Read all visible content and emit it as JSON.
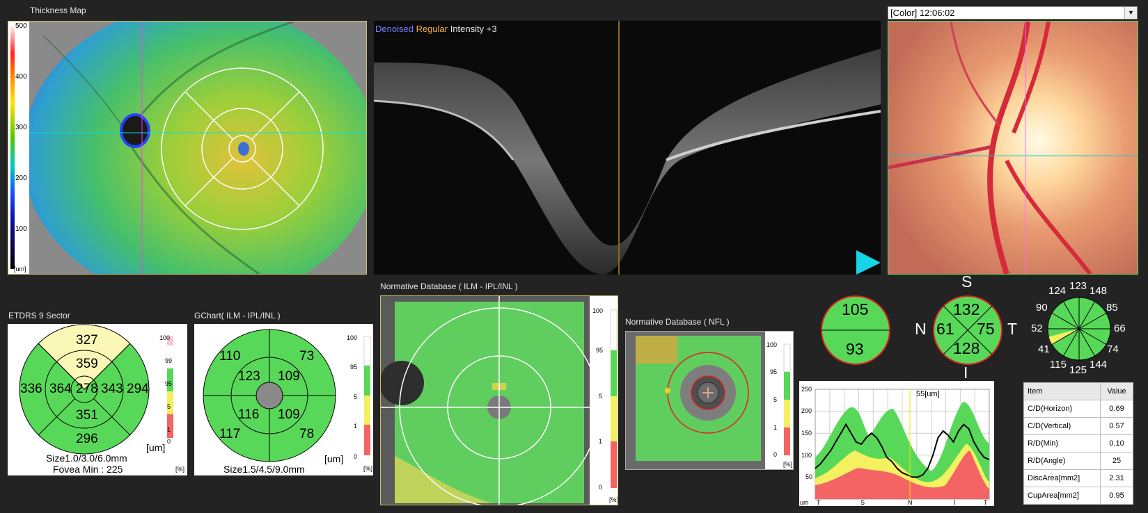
{
  "thickness_map": {
    "title": "Thickness Map",
    "scale_ticks": [
      "500",
      "400",
      "300",
      "200",
      "100"
    ],
    "unit": "[um]"
  },
  "bscan": {
    "label_denoised": "Denoised",
    "label_regular": "Regular",
    "label_intensity": "Intensity +3",
    "colors": {
      "denoised": "#6d7dff",
      "regular": "#ffb347"
    }
  },
  "fundus": {
    "selector_value": "[Color] 12:06:02"
  },
  "etdrs": {
    "title": "ETDRS 9 Sector",
    "center": "278",
    "inner": {
      "superior": "359",
      "nasal": "343",
      "inferior": "351",
      "temporal": "364"
    },
    "outer": {
      "superior": "327",
      "nasal": "294",
      "inferior": "296",
      "temporal": "336"
    },
    "size_text": "Size1.0/3.0/6.0mm",
    "fovea_text": "Fovea Min : 225",
    "unit": "[um]",
    "scale_ticks": [
      "100",
      "99",
      "95",
      "5",
      "1",
      "0"
    ],
    "scale_unit": "[%]"
  },
  "gchart": {
    "title": "GChart( ILM - IPL/INL )",
    "inner": {
      "top_left": "123",
      "top_right": "109",
      "bottom_left": "116",
      "bottom_right": "109"
    },
    "outer": {
      "top_left": "110",
      "top_right": "73",
      "bottom_left": "117",
      "bottom_right": "78"
    },
    "size_text": "Size1.5/4.5/9.0mm",
    "unit": "[um]",
    "scale_ticks": [
      "100",
      "95",
      "5",
      "1",
      "0"
    ],
    "scale_unit": "[%]"
  },
  "norm_gcl": {
    "title": "Normative Database ( ILM - IPL/INL )",
    "scale_ticks": [
      "100",
      "95",
      "5",
      "1",
      "0"
    ],
    "scale_unit": "[%]"
  },
  "norm_nfl": {
    "title": "Normative Database ( NFL )",
    "scale_ticks": [
      "100",
      "95",
      "5",
      "1",
      "0"
    ],
    "scale_unit": "[%]"
  },
  "nfl_half": {
    "superior": "105",
    "inferior": "93"
  },
  "nfl_quadrant": {
    "S": "S",
    "N": "N",
    "T": "T",
    "I": "I",
    "superior": "132",
    "nasal": "61",
    "temporal": "75",
    "inferior": "128"
  },
  "nfl_clock": {
    "values": [
      "123",
      "148",
      "85",
      "66",
      "74",
      "144",
      "125",
      "115",
      "41",
      "52",
      "90",
      "124"
    ]
  },
  "tsnit": {
    "title": "55[um]",
    "y_ticks": [
      "250",
      "200",
      "150",
      "100",
      "50"
    ],
    "x_labels": [
      "T",
      "S",
      "N",
      "I",
      "T"
    ],
    "unit": "um",
    "chart_data": {
      "type": "line",
      "x_categories": [
        "T",
        "S",
        "N",
        "I",
        "T"
      ],
      "ylim": [
        0,
        250
      ],
      "series": [
        {
          "values": [
            70,
            80,
            95,
            110,
            130,
            150,
            170,
            150,
            130,
            125,
            140,
            150,
            140,
            120,
            95,
            85,
            70,
            60,
            55,
            50,
            50,
            55,
            70,
            100,
            140,
            155,
            145,
            130,
            155,
            170,
            160,
            130,
            110,
            95,
            90
          ]
        }
      ]
    }
  },
  "cd_table": {
    "header": {
      "item": "Item",
      "value": "Value"
    },
    "rows": [
      {
        "item": "C/D(Horizon)",
        "value": "0.69"
      },
      {
        "item": "C/D(Vertical)",
        "value": "0.57"
      },
      {
        "item": "R/D(Min)",
        "value": "0.10"
      },
      {
        "item": "R/D(Angle)",
        "value": "25"
      },
      {
        "item": "DiscArea[mm2]",
        "value": "2.31"
      },
      {
        "item": "CupArea[mm2]",
        "value": "0.95"
      }
    ]
  }
}
